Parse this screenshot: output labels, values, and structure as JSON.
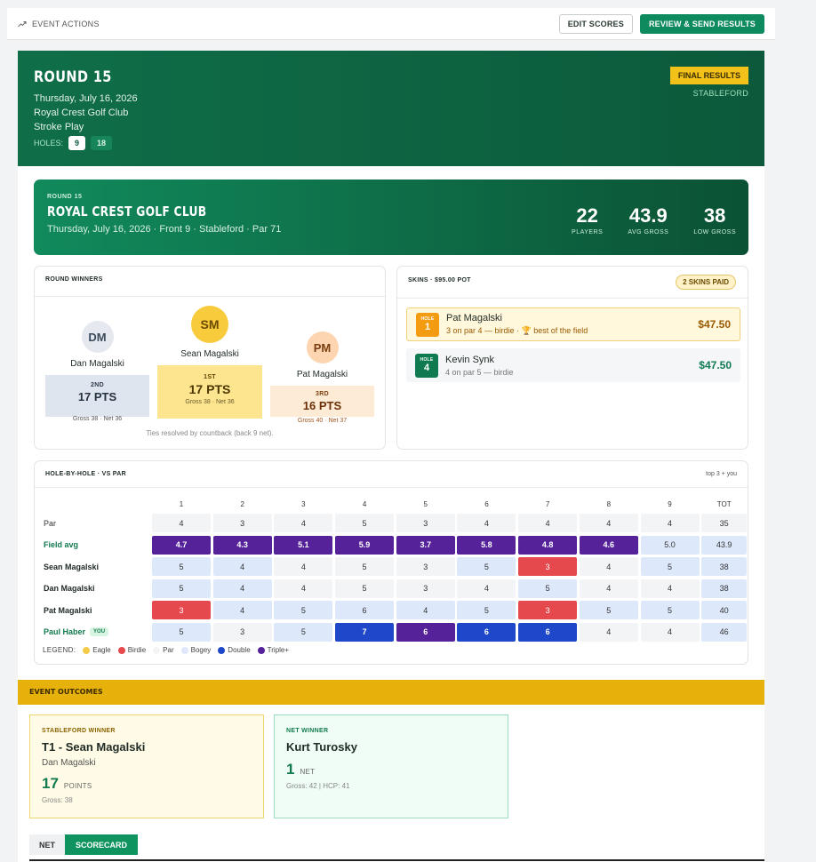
{
  "topbar": {
    "actions_label": "EVENT ACTIONS",
    "edit_scores": "EDIT SCORES",
    "review_send": "REVIEW & SEND RESULTS"
  },
  "hero": {
    "round": "ROUND 15",
    "date": "Thursday, July 16, 2026",
    "course": "Royal Crest Golf Club",
    "format": "Stroke Play",
    "holes_label": "HOLES:",
    "holes_options": [
      "9",
      "18"
    ],
    "badge": "FINAL RESULTS",
    "scoring": "STABLEFORD"
  },
  "summary": {
    "round": "ROUND 15",
    "club": "ROYAL CREST GOLF CLUB",
    "subtitle": "Thursday, July 16, 2026 · Front 9 · Stableford · Par 71",
    "stats": [
      {
        "value": "22",
        "label": "PLAYERS"
      },
      {
        "value": "43.9",
        "label": "AVG GROSS"
      },
      {
        "value": "38",
        "label": "LOW GROSS"
      }
    ]
  },
  "winners": {
    "title": "ROUND WINNERS",
    "second": {
      "initials": "DM",
      "name": "Dan Magalski",
      "place": "2ND",
      "pts": "17 PTS",
      "gn": "Gross 38 · Net 36"
    },
    "first": {
      "initials": "SM",
      "name": "Sean Magalski",
      "place": "1ST",
      "pts": "17 PTS",
      "gn": "Gross 38 · Net 36"
    },
    "third": {
      "initials": "PM",
      "name": "Pat Magalski",
      "place": "3RD",
      "pts": "16 PTS",
      "gn": "Gross 40 · Net 37"
    },
    "tie_note": "Ties resolved by countback (back 9 net)."
  },
  "skins": {
    "title": "SKINS · $95.00 POT",
    "badge": "2 SKINS PAID",
    "hole_label": "HOLE",
    "rows": [
      {
        "hole": "1",
        "name": "Pat Magalski",
        "desc": "3 on par 4 — birdie · 🏆 best of the field",
        "amount": "$47.50"
      },
      {
        "hole": "4",
        "name": "Kevin Synk",
        "desc": "4 on par 5 — birdie",
        "amount": "$47.50"
      }
    ]
  },
  "hole_by_hole": {
    "title": "HOLE-BY-HOLE · VS PAR",
    "note": "top 3 + you",
    "headers": [
      "1",
      "2",
      "3",
      "4",
      "5",
      "6",
      "7",
      "8",
      "9",
      "TOT"
    ],
    "rows": [
      {
        "label": "Par",
        "style": "plain",
        "cells": [
          "4",
          "3",
          "4",
          "5",
          "3",
          "4",
          "4",
          "4",
          "4",
          "35"
        ],
        "kinds": [
          "par",
          "par",
          "par",
          "par",
          "par",
          "par",
          "par",
          "par",
          "par",
          "par"
        ]
      },
      {
        "label": "Field avg",
        "style": "field",
        "cells": [
          "4.7",
          "4.3",
          "5.1",
          "5.9",
          "3.7",
          "5.8",
          "4.8",
          "4.6",
          "5.0",
          "43.9"
        ],
        "kinds": [
          "triple",
          "triple",
          "triple",
          "triple",
          "triple",
          "triple",
          "triple",
          "triple",
          "bogey",
          "tot"
        ]
      },
      {
        "label": "Sean Magalski",
        "style": "bold",
        "cells": [
          "5",
          "4",
          "4",
          "5",
          "3",
          "5",
          "3",
          "4",
          "5",
          "38"
        ],
        "kinds": [
          "bogey",
          "bogey",
          "par",
          "par",
          "par",
          "bogey",
          "birdie",
          "par",
          "bogey",
          "tot"
        ]
      },
      {
        "label": "Dan Magalski",
        "style": "bold",
        "cells": [
          "5",
          "4",
          "4",
          "5",
          "3",
          "4",
          "5",
          "4",
          "4",
          "38"
        ],
        "kinds": [
          "bogey",
          "bogey",
          "par",
          "par",
          "par",
          "par",
          "bogey",
          "par",
          "par",
          "tot"
        ]
      },
      {
        "label": "Pat Magalski",
        "style": "bold",
        "cells": [
          "3",
          "4",
          "5",
          "6",
          "4",
          "5",
          "3",
          "5",
          "5",
          "40"
        ],
        "kinds": [
          "birdie",
          "bogey",
          "bogey",
          "bogey",
          "bogey",
          "bogey",
          "birdie",
          "bogey",
          "bogey",
          "tot"
        ]
      },
      {
        "label": "Paul Haber",
        "style": "you",
        "badge": "YOU",
        "cells": [
          "5",
          "3",
          "5",
          "7",
          "6",
          "6",
          "6",
          "4",
          "4",
          "46"
        ],
        "kinds": [
          "bogey",
          "par",
          "bogey",
          "double",
          "triple",
          "double",
          "double",
          "par",
          "par",
          "tot"
        ]
      }
    ],
    "legend_label": "LEGEND:",
    "legend": [
      {
        "label": "Eagle",
        "color": "#f5cb4a"
      },
      {
        "label": "Birdie",
        "color": "#e5484d"
      },
      {
        "label": "Par",
        "color": "#f3f4f5"
      },
      {
        "label": "Bogey",
        "color": "#dde8fb"
      },
      {
        "label": "Double",
        "color": "#1e48c9"
      },
      {
        "label": "Triple+",
        "color": "#55229a"
      }
    ]
  },
  "outcomes": {
    "title": "EVENT OUTCOMES",
    "stableford": {
      "label": "STABLEFORD WINNER",
      "name": "T1 - Sean Magalski",
      "second": "Dan Magalski",
      "value": "17",
      "unit": "POINTS",
      "gross": "Gross: 38"
    },
    "net": {
      "label": "NET WINNER",
      "name": "Kurt Turosky",
      "value": "1",
      "unit": "NET",
      "gross": "Gross: 42 | HCP: 41"
    }
  },
  "tabs": {
    "net": "NET",
    "scorecard": "SCORECARD"
  },
  "colors": {
    "green": "#0e8a5f",
    "dark_green": "#0c5a3b",
    "gold": "#e6b10b"
  }
}
